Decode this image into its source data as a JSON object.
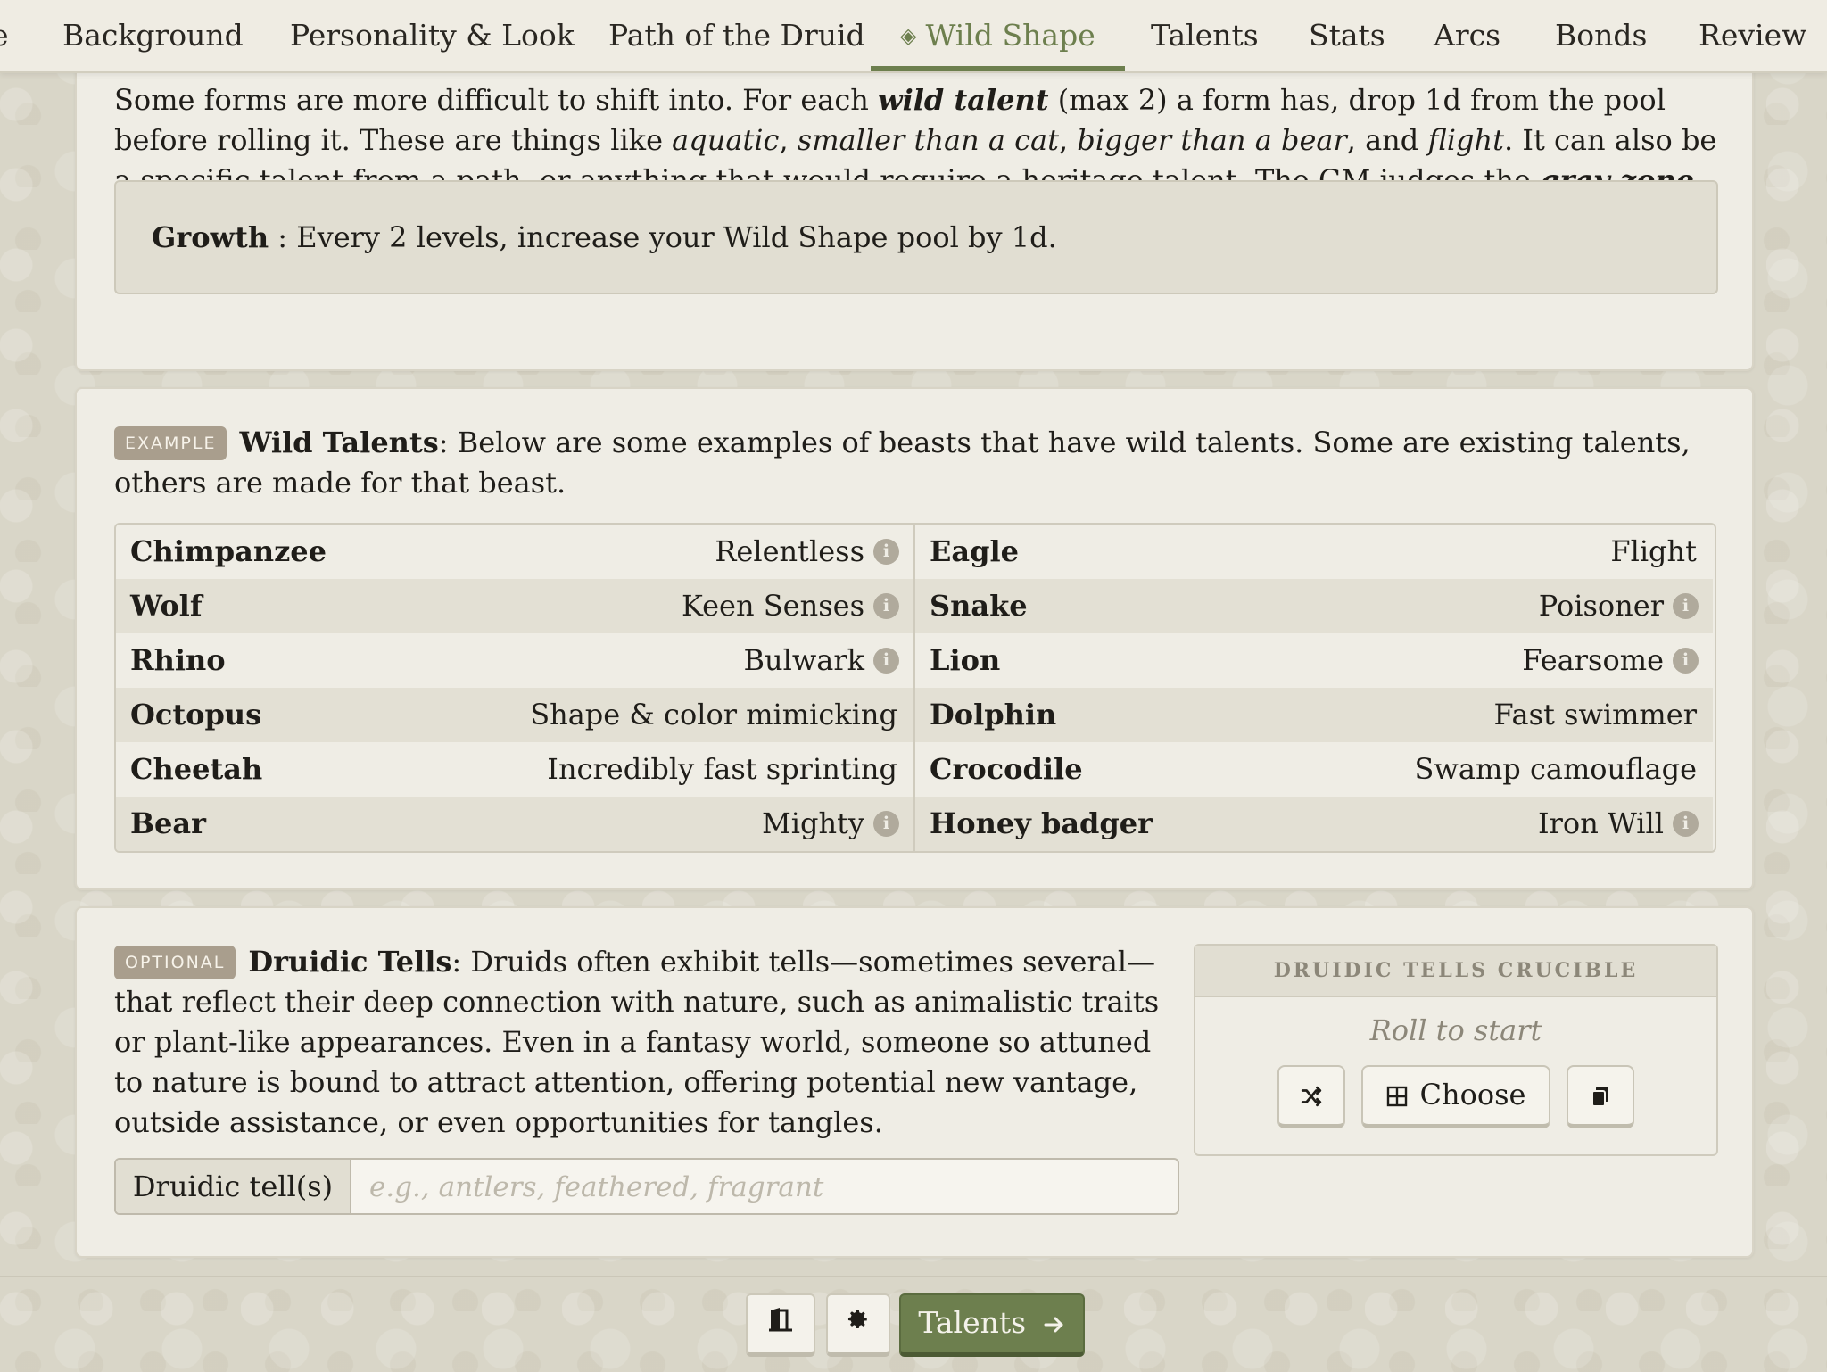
{
  "tabs": {
    "partial": "e",
    "background": "Background",
    "personality": "Personality & Look",
    "path": "Path of the Druid",
    "wild_shape": "Wild Shape",
    "talents": "Talents",
    "stats": "Stats",
    "arcs": "Arcs",
    "bonds": "Bonds",
    "review": "Review"
  },
  "intro": {
    "p1": "Some forms are more difficult to shift into. For each ",
    "wild_talent": "wild talent",
    "p2": " (max 2) a form has, drop 1d from the pool before rolling it. These are things like ",
    "aquatic": "aquatic",
    "c1": ", ",
    "smaller": "smaller than a cat",
    "c2": ", ",
    "bigger": "bigger than a bear",
    "c3": ", and ",
    "flight": "flight",
    "p3": ". It can also be a specific talent from a path, or anything that would require a heritage talent. The GM judges the ",
    "gray_zone": "gray zone",
    "p4": "."
  },
  "growth": {
    "label": "Growth",
    "text": " : Every 2 levels, increase your Wild Shape pool by 1d."
  },
  "wild_talents": {
    "tag": "EXAMPLE",
    "title": "Wild Talents",
    "text": ": Below are some examples of beasts that have wild talents. Some are existing talents, others are made for that beast.",
    "left": [
      {
        "beast": "Chimpanzee",
        "talent": "Relentless"
      },
      {
        "beast": "Wolf",
        "talent": "Keen Senses"
      },
      {
        "beast": "Rhino",
        "talent": "Bulwark"
      },
      {
        "beast": "Octopus",
        "talent": "Shape & color mimicking"
      },
      {
        "beast": "Cheetah",
        "talent": "Incredibly fast sprinting"
      },
      {
        "beast": "Bear",
        "talent": "Mighty"
      }
    ],
    "right": [
      {
        "beast": "Eagle",
        "talent": "Flight"
      },
      {
        "beast": "Snake",
        "talent": "Poisoner"
      },
      {
        "beast": "Lion",
        "talent": "Fearsome"
      },
      {
        "beast": "Dolphin",
        "talent": "Fast swimmer"
      },
      {
        "beast": "Crocodile",
        "talent": "Swamp camouflage"
      },
      {
        "beast": "Honey badger",
        "talent": "Iron Will"
      }
    ],
    "info_glyph": "i"
  },
  "druidic_tells": {
    "tag": "OPTIONAL",
    "title": "Druidic Tells",
    "text": ": Druids often exhibit tells—sometimes several—that reflect their deep connection with nature, such as animalistic traits or plant-like appearances. Even in a fantasy world, someone so attuned to nature is bound to attract attention, offering potential new vantage, outside assistance, or even opportunities for tangles.",
    "field_label": "Druidic tell(s)",
    "field_placeholder": "e.g., antlers, feathered, fragrant",
    "field_value": ""
  },
  "crucible": {
    "title": "DRUIDIC TELLS CRUCIBLE",
    "status": "Roll to start",
    "choose_label": "Choose",
    "icons": [
      "shuffle-icon",
      "grid-icon",
      "copy-icon"
    ]
  },
  "footer": {
    "next_label": "Talents",
    "icons": [
      "exit-door-icon",
      "gear-icon",
      "arrow-right-icon"
    ]
  },
  "colors": {
    "accent": "#6d7f4e",
    "tag_bg": "#a99e8d",
    "card_bg": "#efede5",
    "page_bg": "#d9d6c8"
  }
}
